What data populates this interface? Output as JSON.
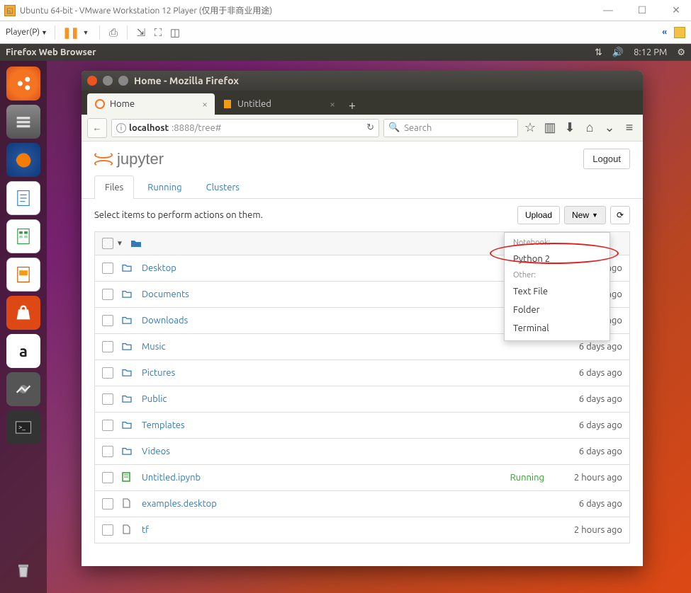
{
  "vmware": {
    "title": "Ubuntu 64-bit - VMware Workstation 12 Player (仅用于非商业用途)",
    "player_btn": "Player(P)"
  },
  "ubuntu_panel": {
    "title": "Firefox Web Browser",
    "time": "8:12 PM"
  },
  "ff_window": {
    "title": "Home - Mozilla Firefox",
    "tabs": [
      {
        "label": "Home",
        "active": true
      },
      {
        "label": "Untitled",
        "active": false
      }
    ],
    "url_host": "localhost",
    "url_path": ":8888/tree#",
    "search_placeholder": "Search"
  },
  "jupyter": {
    "logo_text": "jupyter",
    "logout": "Logout",
    "tabs": [
      {
        "label": "Files",
        "active": true
      },
      {
        "label": "Running",
        "active": false
      },
      {
        "label": "Clusters",
        "active": false
      }
    ],
    "hint": "Select items to perform actions on them.",
    "upload": "Upload",
    "new": "New",
    "new_menu": {
      "section1": "Notebook:",
      "item_python": "Python 2",
      "section2": "Other:",
      "item_text": "Text File",
      "item_folder": "Folder",
      "item_terminal": "Terminal"
    },
    "rows": [
      {
        "type": "folder",
        "name": "Desktop",
        "time": "ago"
      },
      {
        "type": "folder",
        "name": "Documents",
        "time": "ago"
      },
      {
        "type": "folder",
        "name": "Downloads",
        "time": "ago"
      },
      {
        "type": "folder",
        "name": "Music",
        "time": "6 days ago"
      },
      {
        "type": "folder",
        "name": "Pictures",
        "time": "6 days ago"
      },
      {
        "type": "folder",
        "name": "Public",
        "time": "6 days ago"
      },
      {
        "type": "folder",
        "name": "Templates",
        "time": "6 days ago"
      },
      {
        "type": "folder",
        "name": "Videos",
        "time": "6 days ago"
      },
      {
        "type": "notebook",
        "name": "Untitled.ipynb",
        "status": "Running",
        "time": "2 hours ago"
      },
      {
        "type": "file",
        "name": "examples.desktop",
        "time": "6 days ago"
      },
      {
        "type": "file",
        "name": "tf",
        "time": "2 hours ago"
      }
    ]
  }
}
